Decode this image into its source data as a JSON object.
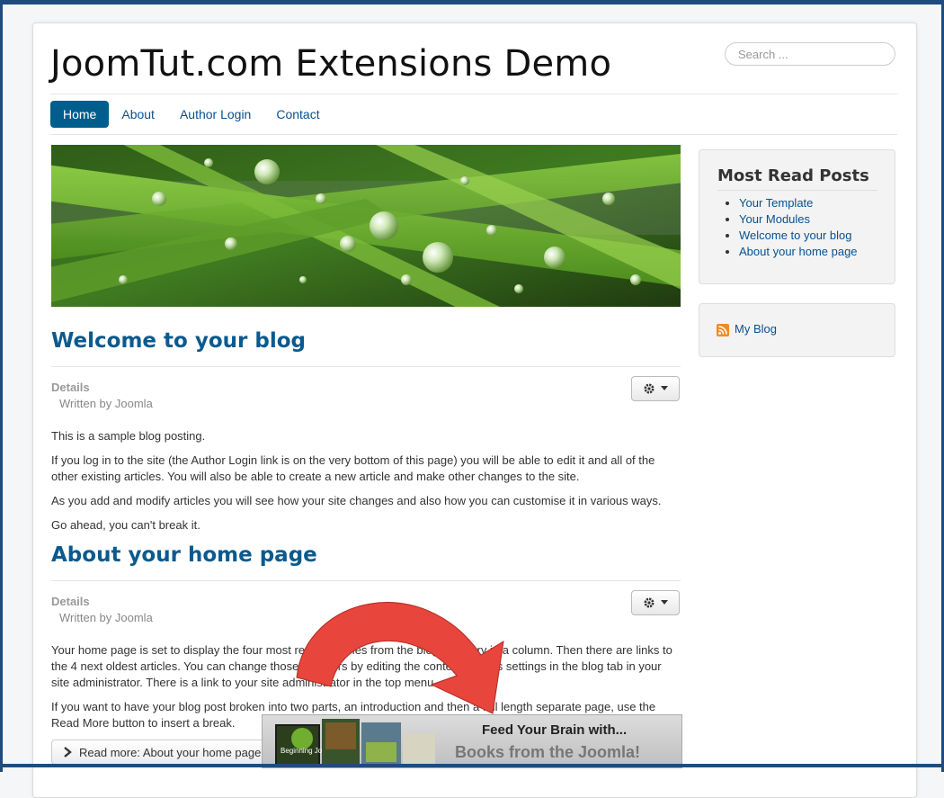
{
  "site": {
    "title": "JoomTut.com Extensions Demo",
    "search_placeholder": "Search ..."
  },
  "nav": {
    "items": [
      {
        "label": "Home",
        "active": true
      },
      {
        "label": "About"
      },
      {
        "label": "Author Login"
      },
      {
        "label": "Contact"
      }
    ]
  },
  "articles": [
    {
      "title": "Welcome to your blog",
      "details_label": "Details",
      "written_by": "Written by Joomla",
      "paragraphs": [
        "This is a sample blog posting.",
        "If you log in to the site (the Author Login link is on the very bottom of this page) you will be able to edit it and all of the other existing articles. You will also be able to create a new article and make other changes to the site.",
        "As you add and modify articles you will see how your site changes and also how you can customise it in various ways.",
        "Go ahead, you can't break it."
      ]
    },
    {
      "title": "About your home page",
      "details_label": "Details",
      "written_by": "Written by Joomla",
      "paragraphs": [
        "Your home page is set to display the four most recent articles from the blog category in a column. Then there are links to the 4 next oldest articles. You can change those numbers by editing the content options settings in the blog tab in your site administrator. There is a link to your site administrator in the top menu.",
        "If you want to have your blog post broken into two parts, an introduction and then a full length separate page, use the Read More button to insert a break."
      ],
      "read_more": "Read more: About your home page"
    }
  ],
  "sidebar": {
    "most_read_title": "Most Read Posts",
    "most_read_items": [
      "Your Template",
      "Your Modules",
      "Welcome to your blog",
      "About your home page"
    ],
    "feed_label": "My Blog"
  },
  "ad": {
    "line1": "Feed Your Brain with...",
    "line2": "Books from the Joomla! Shop",
    "book_cover_text": "Beginning Joomla!",
    "arrow_color": "#e8453c"
  },
  "colors": {
    "link": "#08518f",
    "title": "#0a5a8e",
    "nav_active": "#005e8d",
    "frame": "#1f4c7f"
  }
}
